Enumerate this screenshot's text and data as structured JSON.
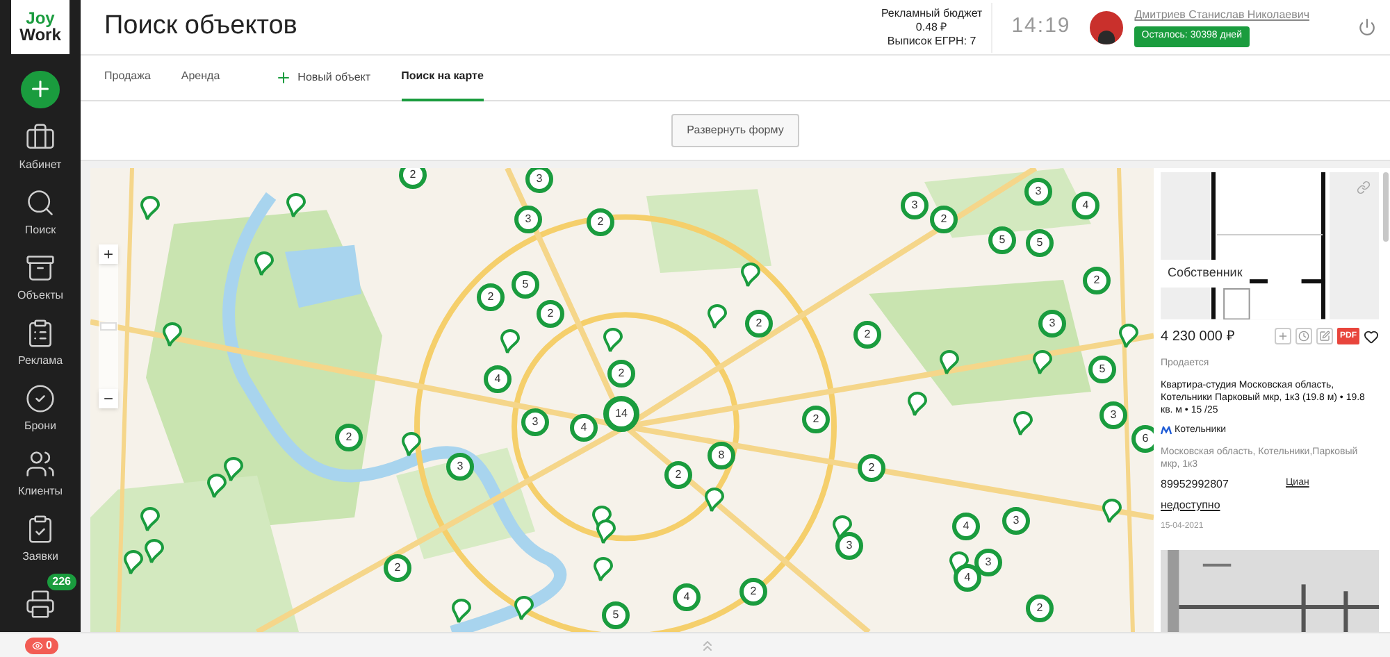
{
  "logo": {
    "lines": [
      "Joy",
      "Work"
    ]
  },
  "sidebar": {
    "items": [
      {
        "label": "Кабинет"
      },
      {
        "label": "Поиск"
      },
      {
        "label": "Объекты"
      },
      {
        "label": "Реклама"
      },
      {
        "label": "Брони"
      },
      {
        "label": "Клиенты"
      },
      {
        "label": "Заявки"
      },
      {
        "badge": "226"
      }
    ]
  },
  "header": {
    "title": "Поиск объектов",
    "budget": {
      "label": "Рекламный бюджет",
      "amount": "0.48 ₽",
      "egrn": "Выписок ЕГРН: 7"
    },
    "time": "14:19",
    "user": {
      "name": "Дмитриев Станислав Николаевич",
      "days": "Осталось: 30398 дней"
    }
  },
  "tabs": [
    {
      "label": "Продажа",
      "kind": "tab",
      "selected": false
    },
    {
      "label": "Аренда",
      "kind": "tab",
      "selected": false
    },
    {
      "label": "Новый объект",
      "kind": "action",
      "selected": false
    },
    {
      "label": "Поиск на карте",
      "kind": "tab",
      "selected": true
    }
  ],
  "expand_button": "Развернуть форму",
  "map": {
    "zoom_in": "+",
    "zoom_out": "−",
    "clusters": [
      {
        "count": "2"
      },
      {
        "count": "3"
      },
      {
        "count": "3"
      },
      {
        "count": "2"
      },
      {
        "count": "3"
      },
      {
        "count": "2"
      },
      {
        "count": "3"
      },
      {
        "count": "4"
      },
      {
        "count": "5"
      },
      {
        "count": "5"
      },
      {
        "count": "2"
      },
      {
        "count": "2"
      },
      {
        "count": "5"
      },
      {
        "count": "2"
      },
      {
        "count": "2"
      },
      {
        "count": "2"
      },
      {
        "count": "3"
      },
      {
        "count": "4"
      },
      {
        "count": "2"
      },
      {
        "count": "14"
      },
      {
        "count": "3"
      },
      {
        "count": "4"
      },
      {
        "count": "2"
      },
      {
        "count": "3"
      },
      {
        "count": "8"
      },
      {
        "count": "2"
      },
      {
        "count": "2"
      },
      {
        "count": "2"
      },
      {
        "count": "5"
      },
      {
        "count": "3"
      },
      {
        "count": "6"
      },
      {
        "count": "2"
      },
      {
        "count": "3"
      },
      {
        "count": "4"
      },
      {
        "count": "3"
      },
      {
        "count": "3"
      },
      {
        "count": "4"
      },
      {
        "count": "4"
      },
      {
        "count": "2"
      },
      {
        "count": "5"
      },
      {
        "count": "2"
      }
    ]
  },
  "listing": {
    "owner": "Собственник",
    "price": "4 230 000 ₽",
    "pdf": "PDF",
    "favorite": false,
    "status": "Продается",
    "title": "Квартира-студия Московская область, Котельники Парковый мкр, 1к3 (19.8 м) • 19.8 кв. м • 15 /25",
    "metro": "Котельники",
    "address": "Московская область, Котельники,Парковый мкр, 1к3",
    "phone": "89952992807",
    "source": "Циан",
    "phone_status": "недоступно",
    "date": "15-04-2021"
  },
  "bottom_bar": {
    "alerts": "0"
  }
}
